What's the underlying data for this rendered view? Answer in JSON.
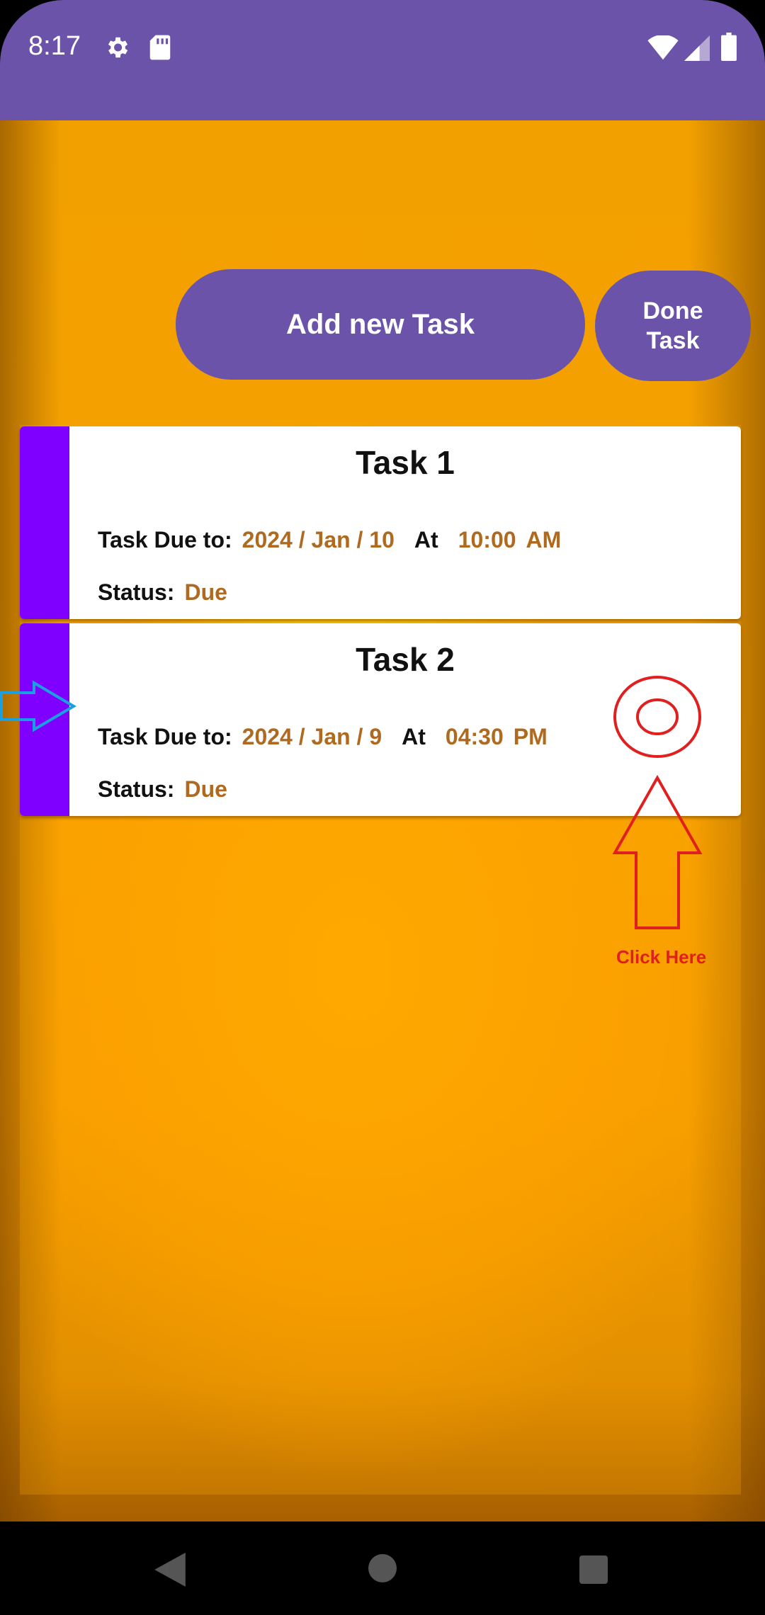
{
  "status_bar": {
    "time": "8:17",
    "icons": [
      "gear-icon",
      "sd-card-icon",
      "wifi-icon",
      "signal-icon",
      "battery-icon"
    ]
  },
  "buttons": {
    "add_task": "Add new Task",
    "done_task_line1": "Done",
    "done_task_line2": "Task"
  },
  "tasks": [
    {
      "title": "Task 1",
      "due_label": "Task Due to:",
      "date": "2024 / Jan / 10",
      "at_label": "At",
      "time": "10:00",
      "ampm": "AM",
      "status_label": "Status:",
      "status": "Due"
    },
    {
      "title": "Task 2",
      "due_label": "Task Due to:",
      "date": "2024 / Jan / 9",
      "at_label": "At",
      "time": "04:30",
      "ampm": "PM",
      "status_label": "Status:",
      "status": "Due"
    }
  ],
  "annotation": {
    "label": "Click Here"
  },
  "nav_bar": {
    "icons": [
      "back-icon",
      "home-icon",
      "recents-icon"
    ]
  },
  "colors": {
    "primary": "#6a53a8",
    "accent_bar": "#7f00ff",
    "value_text": "#b06a20",
    "annotation_red": "#e02020",
    "annotation_blue": "#1aa0e0"
  }
}
